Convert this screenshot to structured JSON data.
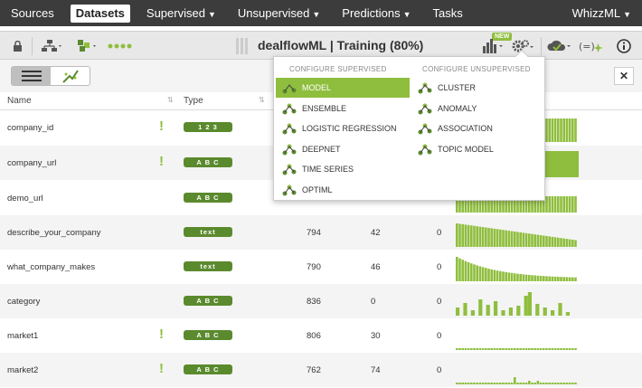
{
  "nav": {
    "items": [
      {
        "label": "Sources"
      },
      {
        "label": "Datasets",
        "active": true
      },
      {
        "label": "Supervised",
        "caret": true
      },
      {
        "label": "Unsupervised",
        "caret": true
      },
      {
        "label": "Predictions",
        "caret": true
      },
      {
        "label": "Tasks"
      }
    ],
    "user": "WhizzML"
  },
  "toolbar": {
    "title": "dealflowML | Training (80%)",
    "new_badge": "NEW"
  },
  "table": {
    "headers": {
      "name": "Name",
      "type": "Type"
    },
    "rows": [
      {
        "name": "company_id",
        "warn": true,
        "type": "1 2 3",
        "n1": "",
        "n2": "",
        "n3": "",
        "spark": [
          14,
          14,
          13,
          13,
          13,
          13,
          13,
          13,
          13,
          13,
          13,
          13,
          13,
          13,
          13,
          13,
          13,
          13,
          13,
          13,
          13,
          13,
          13,
          13,
          13,
          13,
          13,
          13,
          13,
          13,
          13,
          13,
          13,
          13,
          13,
          13,
          13,
          13,
          13,
          13,
          13,
          13,
          13,
          13,
          13,
          13,
          13,
          13,
          13,
          13,
          13,
          13,
          13,
          13,
          13,
          13,
          13,
          13,
          13,
          13,
          13,
          14,
          13,
          14,
          13,
          14,
          13,
          14,
          14,
          14,
          14,
          14,
          14,
          14,
          14,
          14,
          14,
          14,
          14,
          14,
          14,
          14,
          14,
          14,
          14,
          14,
          14,
          14,
          14,
          14,
          14,
          14,
          14,
          14,
          14,
          14,
          14,
          14,
          14,
          14,
          14,
          14,
          14,
          14,
          14,
          14,
          14,
          14,
          14,
          14,
          14,
          14,
          14,
          14,
          14,
          14,
          14,
          14,
          14,
          14,
          14,
          14,
          14,
          14,
          14,
          14,
          14,
          14,
          14,
          14,
          14,
          14,
          14,
          26,
          26,
          26,
          26,
          26,
          26,
          26,
          26,
          26,
          26,
          26,
          26,
          26,
          26,
          26
        ]
      },
      {
        "name": "company_url",
        "warn": true,
        "type": "A B C",
        "n1": "",
        "n2": "",
        "n3": "",
        "spark": "full"
      },
      {
        "name": "demo_url",
        "warn": false,
        "type": "A B C",
        "n1": "",
        "n2": "",
        "n3": "",
        "spark": "demo"
      },
      {
        "name": "describe_your_company",
        "warn": false,
        "type": "text",
        "n1": "794",
        "n2": "42",
        "n3": "0",
        "spark": "decay1"
      },
      {
        "name": "what_company_makes",
        "warn": false,
        "type": "text",
        "n1": "790",
        "n2": "46",
        "n3": "0",
        "spark": "decay2"
      },
      {
        "name": "category",
        "warn": false,
        "type": "A B C",
        "n1": "836",
        "n2": "0",
        "n3": "0",
        "spark": "cat"
      },
      {
        "name": "market1",
        "warn": true,
        "type": "A B C",
        "n1": "806",
        "n2": "30",
        "n3": "0",
        "spark": "flat"
      },
      {
        "name": "market2",
        "warn": true,
        "type": "A B C",
        "n1": "762",
        "n2": "74",
        "n3": "0",
        "spark": "m2"
      }
    ]
  },
  "dropdown": {
    "supervised_header": "CONFIGURE SUPERVISED",
    "unsupervised_header": "CONFIGURE UNSUPERVISED",
    "supervised": [
      {
        "label": "MODEL",
        "icon": "model-icon",
        "selected": true
      },
      {
        "label": "ENSEMBLE",
        "icon": "ensemble-icon"
      },
      {
        "label": "LOGISTIC REGRESSION",
        "icon": "logistic-regression-icon"
      },
      {
        "label": "DEEPNET",
        "icon": "deepnet-icon"
      },
      {
        "label": "TIME SERIES",
        "icon": "time-series-icon"
      },
      {
        "label": "OPTIML",
        "icon": "optiml-icon"
      }
    ],
    "unsupervised": [
      {
        "label": "CLUSTER",
        "icon": "cluster-icon"
      },
      {
        "label": "ANOMALY",
        "icon": "anomaly-icon"
      },
      {
        "label": "ASSOCIATION",
        "icon": "association-icon"
      },
      {
        "label": "TOPIC MODEL",
        "icon": "topic-model-icon"
      }
    ]
  },
  "colors": {
    "accent": "#8fbe3e",
    "badge": "#5b8a2e",
    "nav": "#3c3c3c"
  }
}
